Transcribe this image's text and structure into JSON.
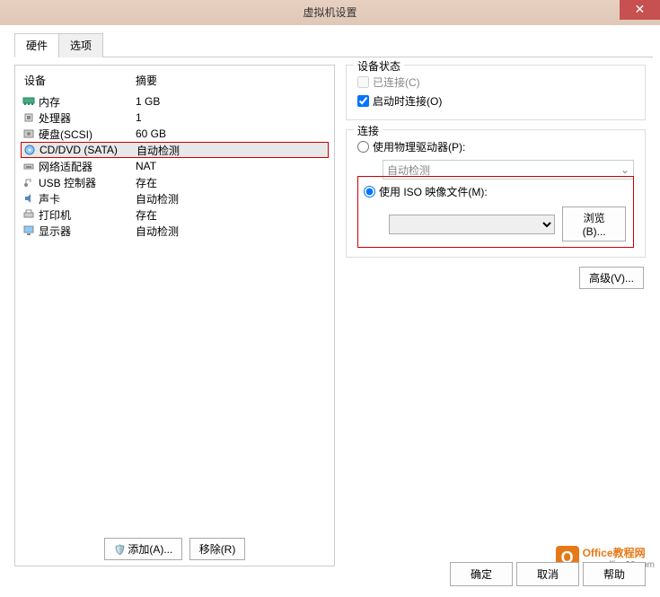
{
  "title": "虚拟机设置",
  "tabs": {
    "hardware": "硬件",
    "options": "选项"
  },
  "headers": {
    "device": "设备",
    "summary": "摘要"
  },
  "hardware": [
    {
      "name": "内存",
      "summary": "1 GB",
      "icon": "memory"
    },
    {
      "name": "处理器",
      "summary": "1",
      "icon": "cpu"
    },
    {
      "name": "硬盘(SCSI)",
      "summary": "60 GB",
      "icon": "hdd"
    },
    {
      "name": "CD/DVD (SATA)",
      "summary": "自动检测",
      "icon": "cd",
      "selected": true
    },
    {
      "name": "网络适配器",
      "summary": "NAT",
      "icon": "net"
    },
    {
      "name": "USB 控制器",
      "summary": "存在",
      "icon": "usb"
    },
    {
      "name": "声卡",
      "summary": "自动检测",
      "icon": "sound"
    },
    {
      "name": "打印机",
      "summary": "存在",
      "icon": "printer"
    },
    {
      "name": "显示器",
      "summary": "自动检测",
      "icon": "display"
    }
  ],
  "buttons": {
    "add": "添加(A)...",
    "remove": "移除(R)"
  },
  "deviceStatus": {
    "title": "设备状态",
    "connected": "已连接(C)",
    "connectAtPowerOn": "启动时连接(O)"
  },
  "connection": {
    "title": "连接",
    "usePhysical": "使用物理驱动器(P):",
    "autoDetect": "自动检测",
    "useIso": "使用 ISO 映像文件(M):",
    "browse": "浏览(B)..."
  },
  "advanced": "高级(V)...",
  "footer": {
    "ok": "确定",
    "cancel": "取消",
    "help": "帮助"
  },
  "watermark": {
    "text": "Office教程网",
    "url": "www.office26.com"
  }
}
